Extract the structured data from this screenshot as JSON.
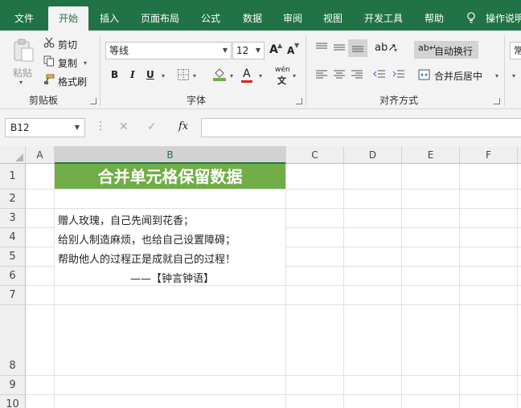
{
  "ribbon_tabs": [
    "文件",
    "开始",
    "插入",
    "页面布局",
    "公式",
    "数据",
    "审阅",
    "视图",
    "开发工具",
    "帮助",
    "操作说明"
  ],
  "active_tab": "开始",
  "clipboard": {
    "paste": "粘贴",
    "cut": "剪切",
    "copy": "复制",
    "format_painter": "格式刷",
    "group": "剪贴板"
  },
  "font": {
    "name": "等线",
    "size": "12",
    "bold": "B",
    "italic": "I",
    "underline": "U",
    "grow": "A",
    "shrink": "A",
    "color_letter": "A",
    "phonetic": "wén",
    "group": "字体"
  },
  "alignment": {
    "wrap_text": "自动换行",
    "merge_center": "合并后居中",
    "group": "对齐方式",
    "number_format_partial": "常"
  },
  "formula_bar": {
    "name_box": "B12",
    "fx": "fx",
    "content": ""
  },
  "columns": [
    "A",
    "B",
    "C",
    "D",
    "E",
    "F"
  ],
  "selected_column": "B",
  "rows": [
    "1",
    "2",
    "3",
    "4",
    "5",
    "6",
    "7",
    "8",
    "9",
    "10"
  ],
  "cells": {
    "b1_merged": "合并单元格保留数据",
    "b3": "赠人玫瑰，自己先闻到花香；",
    "b4": "给别人制造麻烦，也给自己设置障碍；",
    "b5": "帮助他人的过程正是成就自己的过程！",
    "b6": "——【钟言钟语】"
  },
  "colors": {
    "accent": "#217346",
    "merged_fill": "#70ad47"
  }
}
